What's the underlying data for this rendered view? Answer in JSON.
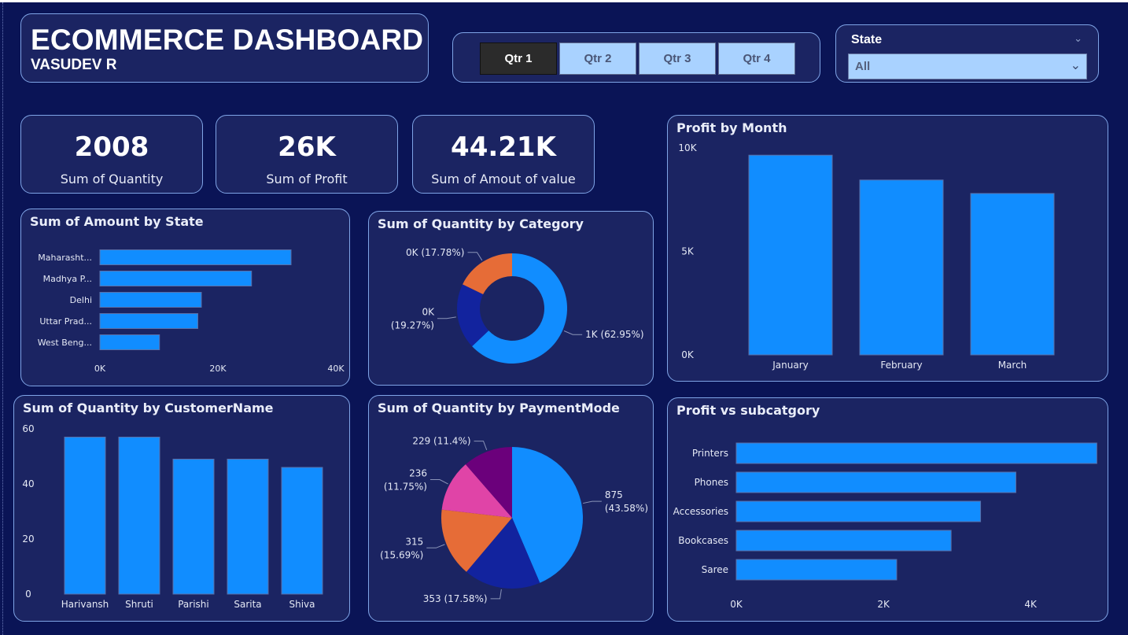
{
  "header": {
    "title": "ECOMMERCE DASHBOARD",
    "subtitle": "VASUDEV R"
  },
  "quarters": {
    "items": [
      "Qtr 1",
      "Qtr 2",
      "Qtr 3",
      "Qtr 4"
    ],
    "active": "Qtr 1"
  },
  "state_filter": {
    "label": "State",
    "value": "All"
  },
  "kpis": [
    {
      "value": "2008",
      "label": "Sum of Quantity"
    },
    {
      "value": "26K",
      "label": "Sum of Profit"
    },
    {
      "value": "44.21K",
      "label": "Sum of Amout of value"
    }
  ],
  "colors": {
    "background": "#0a1456",
    "card": "#1b2462",
    "card_border": "#7fa4e6",
    "bar": "#118dff",
    "bar_border": "#5a6fa8"
  },
  "chart_data": [
    {
      "id": "amount_by_state",
      "type": "bar",
      "orientation": "horizontal",
      "title": "Sum of Amount by State",
      "categories": [
        "Maharasht...",
        "Madhya P...",
        "Delhi",
        "Uttar Prad...",
        "West Beng..."
      ],
      "values": [
        32400,
        25700,
        17200,
        16600,
        10100
      ],
      "xlim": [
        0,
        40000
      ],
      "xticks": [
        "0K",
        "20K",
        "40K"
      ],
      "xtick_values": [
        0,
        20000,
        40000
      ]
    },
    {
      "id": "quantity_by_category",
      "type": "pie",
      "donut": true,
      "title": "Sum of Quantity by Category",
      "slices": [
        {
          "label": "1K (62.95%)",
          "value": 62.95,
          "color": "#118dff"
        },
        {
          "label": "0K (19.27%)",
          "value": 19.27,
          "color": "#12239e"
        },
        {
          "label": "0K (17.78%)",
          "value": 17.78,
          "color": "#e66c37"
        }
      ]
    },
    {
      "id": "profit_by_month",
      "type": "bar",
      "orientation": "vertical",
      "title": "Profit by Month",
      "categories": [
        "January",
        "February",
        "March"
      ],
      "values": [
        9650,
        8450,
        7800
      ],
      "ylim": [
        0,
        10000
      ],
      "yticks": [
        "0K",
        "5K",
        "10K"
      ],
      "ytick_values": [
        0,
        5000,
        10000
      ]
    },
    {
      "id": "quantity_by_customer",
      "type": "bar",
      "orientation": "vertical",
      "title": "Sum of Quantity by CustomerName",
      "categories": [
        "Harivansh",
        "Shruti",
        "Parishi",
        "Sarita",
        "Shiva"
      ],
      "values": [
        57,
        57,
        49,
        49,
        46
      ],
      "ylim": [
        0,
        60
      ],
      "yticks": [
        "0",
        "20",
        "40",
        "60"
      ],
      "ytick_values": [
        0,
        20,
        40,
        60
      ]
    },
    {
      "id": "quantity_by_paymentmode",
      "type": "pie",
      "title": "Sum of Quantity by PaymentMode",
      "slices": [
        {
          "label": "875 (43.58%)",
          "value": 875,
          "color": "#118dff"
        },
        {
          "label": "353 (17.58%)",
          "value": 353,
          "color": "#12239e"
        },
        {
          "label": "315 (15.69%)",
          "value": 315,
          "color": "#e66c37"
        },
        {
          "label": "236 (11.75%)",
          "value": 236,
          "color": "#e044a7"
        },
        {
          "label": "229 (11.4%)",
          "value": 229,
          "color": "#6b007b"
        }
      ]
    },
    {
      "id": "profit_vs_subcategory",
      "type": "bar",
      "orientation": "horizontal",
      "title": "Profit vs subcatgory",
      "categories": [
        "Printers",
        "Phones",
        "Accessories",
        "Bookcases",
        "Saree"
      ],
      "values": [
        4900,
        3800,
        3320,
        2920,
        2180
      ],
      "xlim": [
        0,
        4800
      ],
      "xticks": [
        "0K",
        "2K",
        "4K"
      ],
      "xtick_values": [
        0,
        2000,
        4000
      ]
    }
  ]
}
